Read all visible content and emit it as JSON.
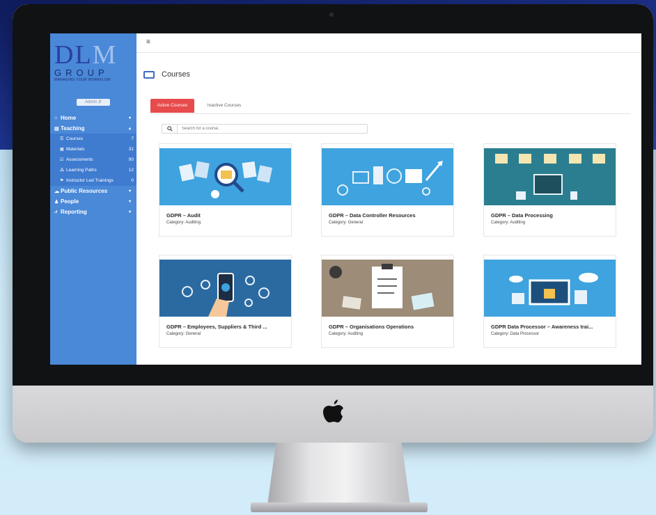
{
  "brand": {
    "logo_top": "DL",
    "logo_m": "M",
    "logo_group": "GROUP",
    "logo_tagline": "MANAGING YOUR WORKFLOW"
  },
  "sidebar": {
    "role_select": "Admin",
    "items": [
      {
        "label": "Home",
        "icon": "home-icon",
        "caret": "▾"
      },
      {
        "label": "Teaching",
        "icon": "book-icon",
        "caret": "▴"
      },
      {
        "label": "Public Resources",
        "icon": "cloud-icon",
        "caret": "▾"
      },
      {
        "label": "People",
        "icon": "person-icon",
        "caret": "▾"
      },
      {
        "label": "Reporting",
        "icon": "chart-icon",
        "caret": "▾"
      }
    ],
    "teaching_sub": [
      {
        "label": "Courses",
        "count": "7",
        "icon": "list-icon"
      },
      {
        "label": "Materials",
        "count": "31",
        "icon": "document-icon"
      },
      {
        "label": "Assessments",
        "count": "90",
        "icon": "checkbox-icon"
      },
      {
        "label": "Learning Paths",
        "count": "12",
        "icon": "path-icon"
      },
      {
        "label": "Instructor Led Trainings",
        "count": "0",
        "icon": "flag-icon"
      }
    ]
  },
  "header": {
    "menu_icon": "hamburger-icon",
    "page_title": "Courses"
  },
  "tabs": [
    {
      "label": "Active Courses",
      "active": true
    },
    {
      "label": "Inactive Courses",
      "active": false
    }
  ],
  "search": {
    "placeholder": "Search for a course."
  },
  "category_prefix": "Category:",
  "courses": [
    {
      "name": "GDPR – Audit",
      "category": "Auditing"
    },
    {
      "name": "GDPR – Data Controller Resources",
      "category": "General"
    },
    {
      "name": "GDPR – Data Processing",
      "category": "Auditing"
    },
    {
      "name": "GDPR – Employees, Suppliers & Third ...",
      "category": "General"
    },
    {
      "name": "GDPR – Organisations Operations",
      "category": "Auditing"
    },
    {
      "name": "GDPR Data Processor – Awareness trai...",
      "category": "Data Processor"
    }
  ],
  "colors": {
    "sidebar": "#4a88d8",
    "active_tab": "#e74b4b",
    "accent": "#3d6cc3"
  }
}
